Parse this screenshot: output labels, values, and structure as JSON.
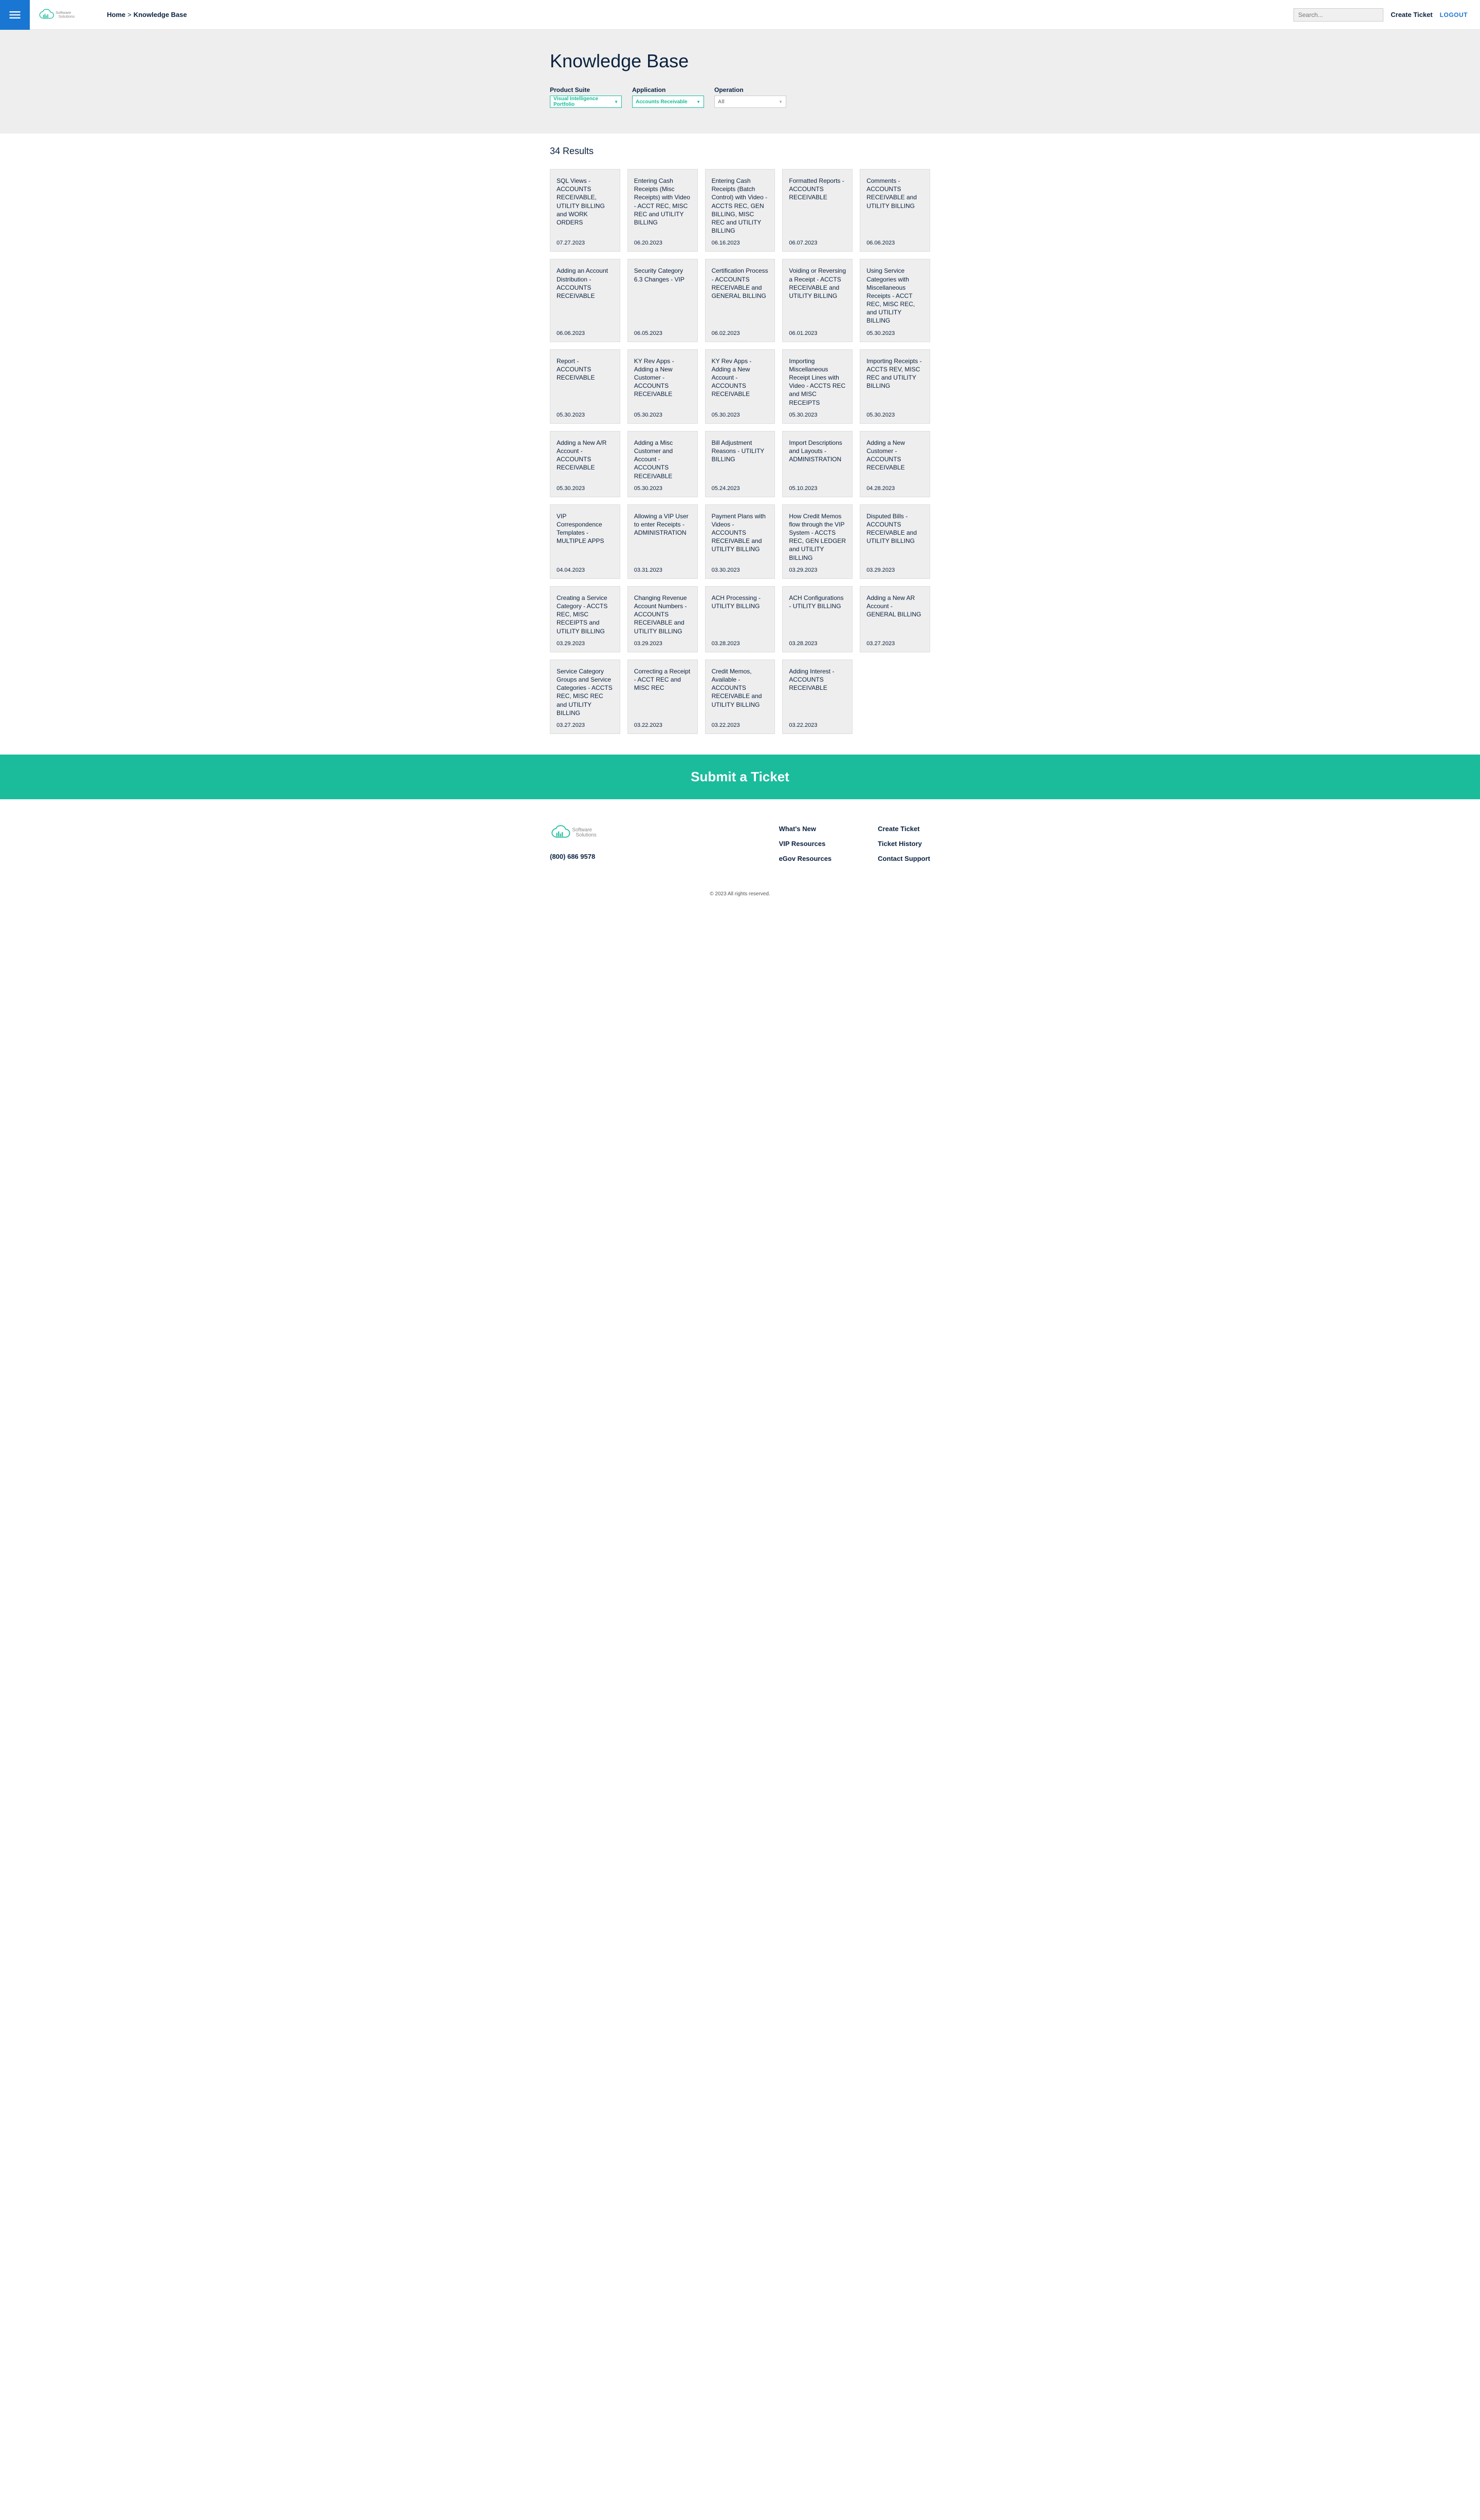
{
  "header": {
    "breadcrumb_home": "Home",
    "breadcrumb_sep": ">",
    "breadcrumb_current": "Knowledge Base",
    "search_placeholder": "Search...",
    "create_ticket": "Create Ticket",
    "logout": "LOGOUT"
  },
  "page": {
    "title": "Knowledge Base",
    "results_count": "34 Results"
  },
  "filters": {
    "suite_label": "Product Suite",
    "suite_value": "Visual Intelligence Portfolio",
    "app_label": "Application",
    "app_value": "Accounts Receivable",
    "op_label": "Operation",
    "op_value": "All"
  },
  "cards": [
    {
      "title": "SQL Views - ACCOUNTS RECEIVABLE, UTILITY BILLING and WORK ORDERS",
      "date": "07.27.2023"
    },
    {
      "title": "Entering Cash Receipts (Misc Receipts) with Video - ACCT REC, MISC REC and UTILITY BILLING",
      "date": "06.20.2023"
    },
    {
      "title": "Entering Cash Receipts (Batch Control) with Video - ACCTS REC, GEN BILLING, MISC REC and UTILITY BILLING",
      "date": "06.16.2023"
    },
    {
      "title": "Formatted Reports - ACCOUNTS RECEIVABLE",
      "date": "06.07.2023"
    },
    {
      "title": "Comments - ACCOUNTS RECEIVABLE and UTILITY BILLING",
      "date": "06.06.2023"
    },
    {
      "title": "Adding an Account Distribution - ACCOUNTS RECEIVABLE",
      "date": "06.06.2023"
    },
    {
      "title": "Security Category 6.3 Changes - VIP",
      "date": "06.05.2023"
    },
    {
      "title": "Certification Process - ACCOUNTS RECEIVABLE and GENERAL BILLING",
      "date": "06.02.2023"
    },
    {
      "title": "Voiding or Reversing a Receipt - ACCTS RECEIVABLE and UTILITY BILLING",
      "date": "06.01.2023"
    },
    {
      "title": "Using Service Categories with Miscellaneous Receipts - ACCT REC, MISC REC, and UTILITY BILLING",
      "date": "05.30.2023"
    },
    {
      "title": "Report - ACCOUNTS RECEIVABLE",
      "date": "05.30.2023"
    },
    {
      "title": "KY Rev Apps - Adding a New Customer - ACCOUNTS RECEIVABLE",
      "date": "05.30.2023"
    },
    {
      "title": "KY Rev Apps - Adding a New Account - ACCOUNTS RECEIVABLE",
      "date": "05.30.2023"
    },
    {
      "title": "Importing Miscellaneous Receipt Lines with Video - ACCTS REC and MISC RECEIPTS",
      "date": "05.30.2023"
    },
    {
      "title": "Importing Receipts - ACCTS REV, MISC REC and UTILITY BILLING",
      "date": "05.30.2023"
    },
    {
      "title": "Adding a New A/R Account - ACCOUNTS RECEIVABLE",
      "date": "05.30.2023"
    },
    {
      "title": "Adding a Misc Customer and Account - ACCOUNTS RECEIVABLE",
      "date": "05.30.2023"
    },
    {
      "title": "Bill Adjustment Reasons - UTILITY BILLING",
      "date": "05.24.2023"
    },
    {
      "title": "Import Descriptions and Layouts - ADMINISTRATION",
      "date": "05.10.2023"
    },
    {
      "title": "Adding a New Customer - ACCOUNTS RECEIVABLE",
      "date": "04.28.2023"
    },
    {
      "title": "VIP Correspondence Templates - MULTIPLE APPS",
      "date": "04.04.2023"
    },
    {
      "title": "Allowing a VIP User to enter Receipts - ADMINISTRATION",
      "date": "03.31.2023"
    },
    {
      "title": "Payment Plans with Videos - ACCOUNTS RECEIVABLE and UTILITY BILLING",
      "date": "03.30.2023"
    },
    {
      "title": "How Credit Memos flow through the VIP System - ACCTS REC, GEN LEDGER and UTILITY BILLING",
      "date": "03.29.2023"
    },
    {
      "title": "Disputed Bills - ACCOUNTS RECEIVABLE and UTILITY BILLING",
      "date": "03.29.2023"
    },
    {
      "title": "Creating a Service Category - ACCTS REC, MISC RECEIPTS and UTILITY BILLING",
      "date": "03.29.2023"
    },
    {
      "title": "Changing Revenue Account Numbers - ACCOUNTS RECEIVABLE and UTILITY BILLING",
      "date": "03.29.2023"
    },
    {
      "title": "ACH Processing - UTILITY BILLING",
      "date": "03.28.2023"
    },
    {
      "title": "ACH Configurations - UTILITY BILLING",
      "date": "03.28.2023"
    },
    {
      "title": "Adding a New AR Account - GENERAL BILLING",
      "date": "03.27.2023"
    },
    {
      "title": "Service Category Groups and Service Categories - ACCTS REC, MISC REC and UTILITY BILLING",
      "date": "03.27.2023"
    },
    {
      "title": "Correcting a Receipt - ACCT REC and MISC REC",
      "date": "03.22.2023"
    },
    {
      "title": "Credit Memos, Available - ACCOUNTS RECEIVABLE and UTILITY BILLING",
      "date": "03.22.2023"
    },
    {
      "title": "Adding Interest - ACCOUNTS RECEIVABLE",
      "date": "03.22.2023"
    }
  ],
  "cta": {
    "title": "Submit a Ticket"
  },
  "footer": {
    "phone": "(800) 686 9578",
    "col1": [
      "What's New",
      "VIP Resources",
      "eGov Resources"
    ],
    "col2": [
      "Create Ticket",
      "Ticket History",
      "Contact Support"
    ],
    "copyright": "© 2023 All rights reserved."
  }
}
